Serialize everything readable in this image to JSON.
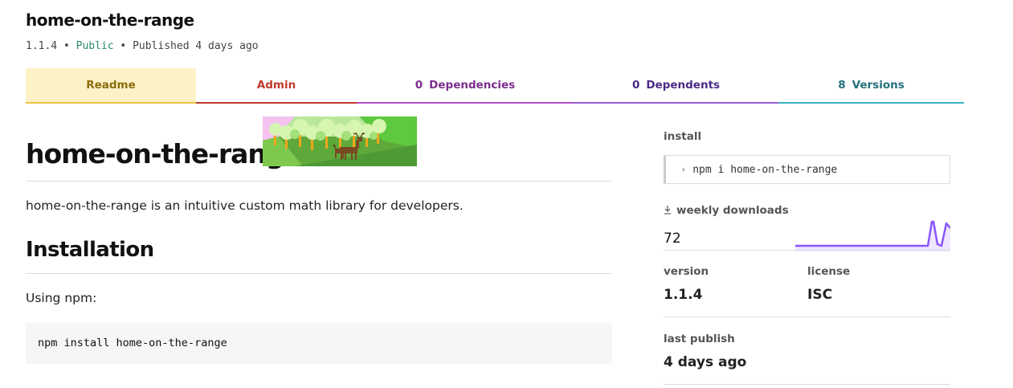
{
  "package": {
    "name": "home-on-the-range",
    "version": "1.1.4",
    "separator": "•",
    "visibility": "Public",
    "published": "Published 4 days ago"
  },
  "tabs": [
    {
      "label": "Readme",
      "count": null,
      "active": true
    },
    {
      "label": "Admin",
      "count": null,
      "active": false
    },
    {
      "label": "Dependencies",
      "count": "0",
      "active": false
    },
    {
      "label": "Dependents",
      "count": "0",
      "active": false
    },
    {
      "label": "Versions",
      "count": "8",
      "active": false
    }
  ],
  "readme": {
    "title": "home-on-the-range",
    "description": "home-on-the-range is an intuitive custom math library for developers.",
    "installation_heading": "Installation",
    "using_text": "Using npm:",
    "code": "npm install home-on-the-range"
  },
  "sidebar": {
    "install_label": "install",
    "install_command": "npm i home-on-the-range",
    "weekly_downloads_label": "weekly downloads",
    "weekly_downloads_value": "72",
    "version_label": "version",
    "version_value": "1.1.4",
    "license_label": "license",
    "license_value": "ISC",
    "last_publish_label": "last publish",
    "last_publish_value": "4 days ago"
  },
  "icons": {
    "download": "download-icon",
    "prompt": "chevron-right-icon"
  },
  "colors": {
    "readme_tab": "#e8c440",
    "admin_tab": "#c0392b",
    "dependencies_tab": "#b04ec8",
    "dependents_tab": "#9a5bd6",
    "versions_tab": "#3ab1bf",
    "public": "#2a8c6a",
    "sparkline": "#8956ff"
  }
}
